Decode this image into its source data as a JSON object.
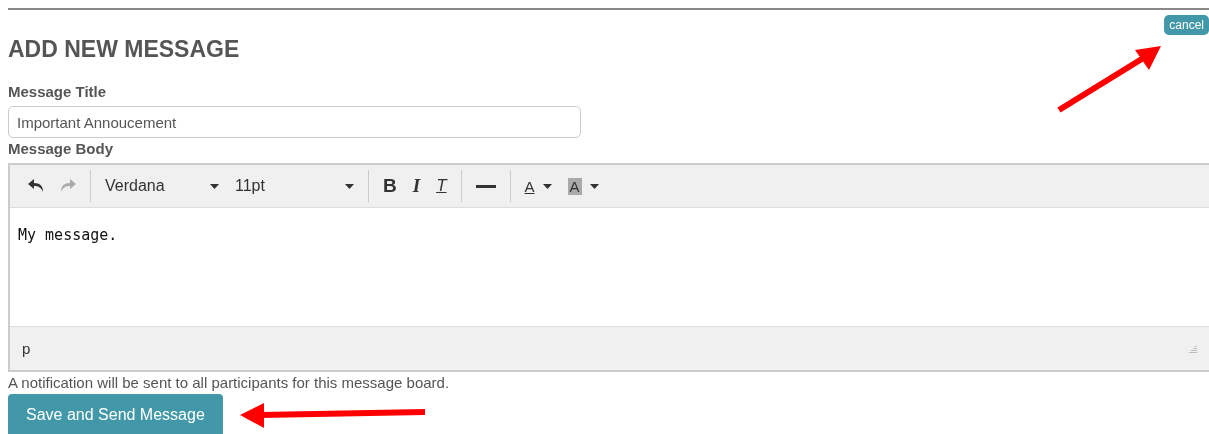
{
  "heading": "ADD NEW MESSAGE",
  "cancel_button": "cancel",
  "title_field": {
    "label": "Message Title",
    "value": "Important Annoucement"
  },
  "body_label": "Message Body",
  "toolbar": [
    [
      {
        "kind": "undo",
        "disabled": false
      },
      {
        "kind": "redo",
        "disabled": true
      }
    ],
    [
      {
        "kind": "select",
        "label": "Verdana"
      },
      {
        "kind": "select",
        "label": "11pt"
      }
    ],
    [
      {
        "kind": "bold",
        "label": "B"
      },
      {
        "kind": "italic",
        "label": "I"
      },
      {
        "kind": "clear",
        "label": "T"
      }
    ],
    [
      {
        "kind": "rule"
      }
    ],
    [
      {
        "kind": "forecolor",
        "label": "A"
      },
      {
        "kind": "backcolor",
        "label": "A"
      }
    ]
  ],
  "editor_text": "My message.",
  "status_path": "p",
  "notice": "A notification will be sent to all participants for this message board.",
  "submit_button": "Save and Send Message"
}
